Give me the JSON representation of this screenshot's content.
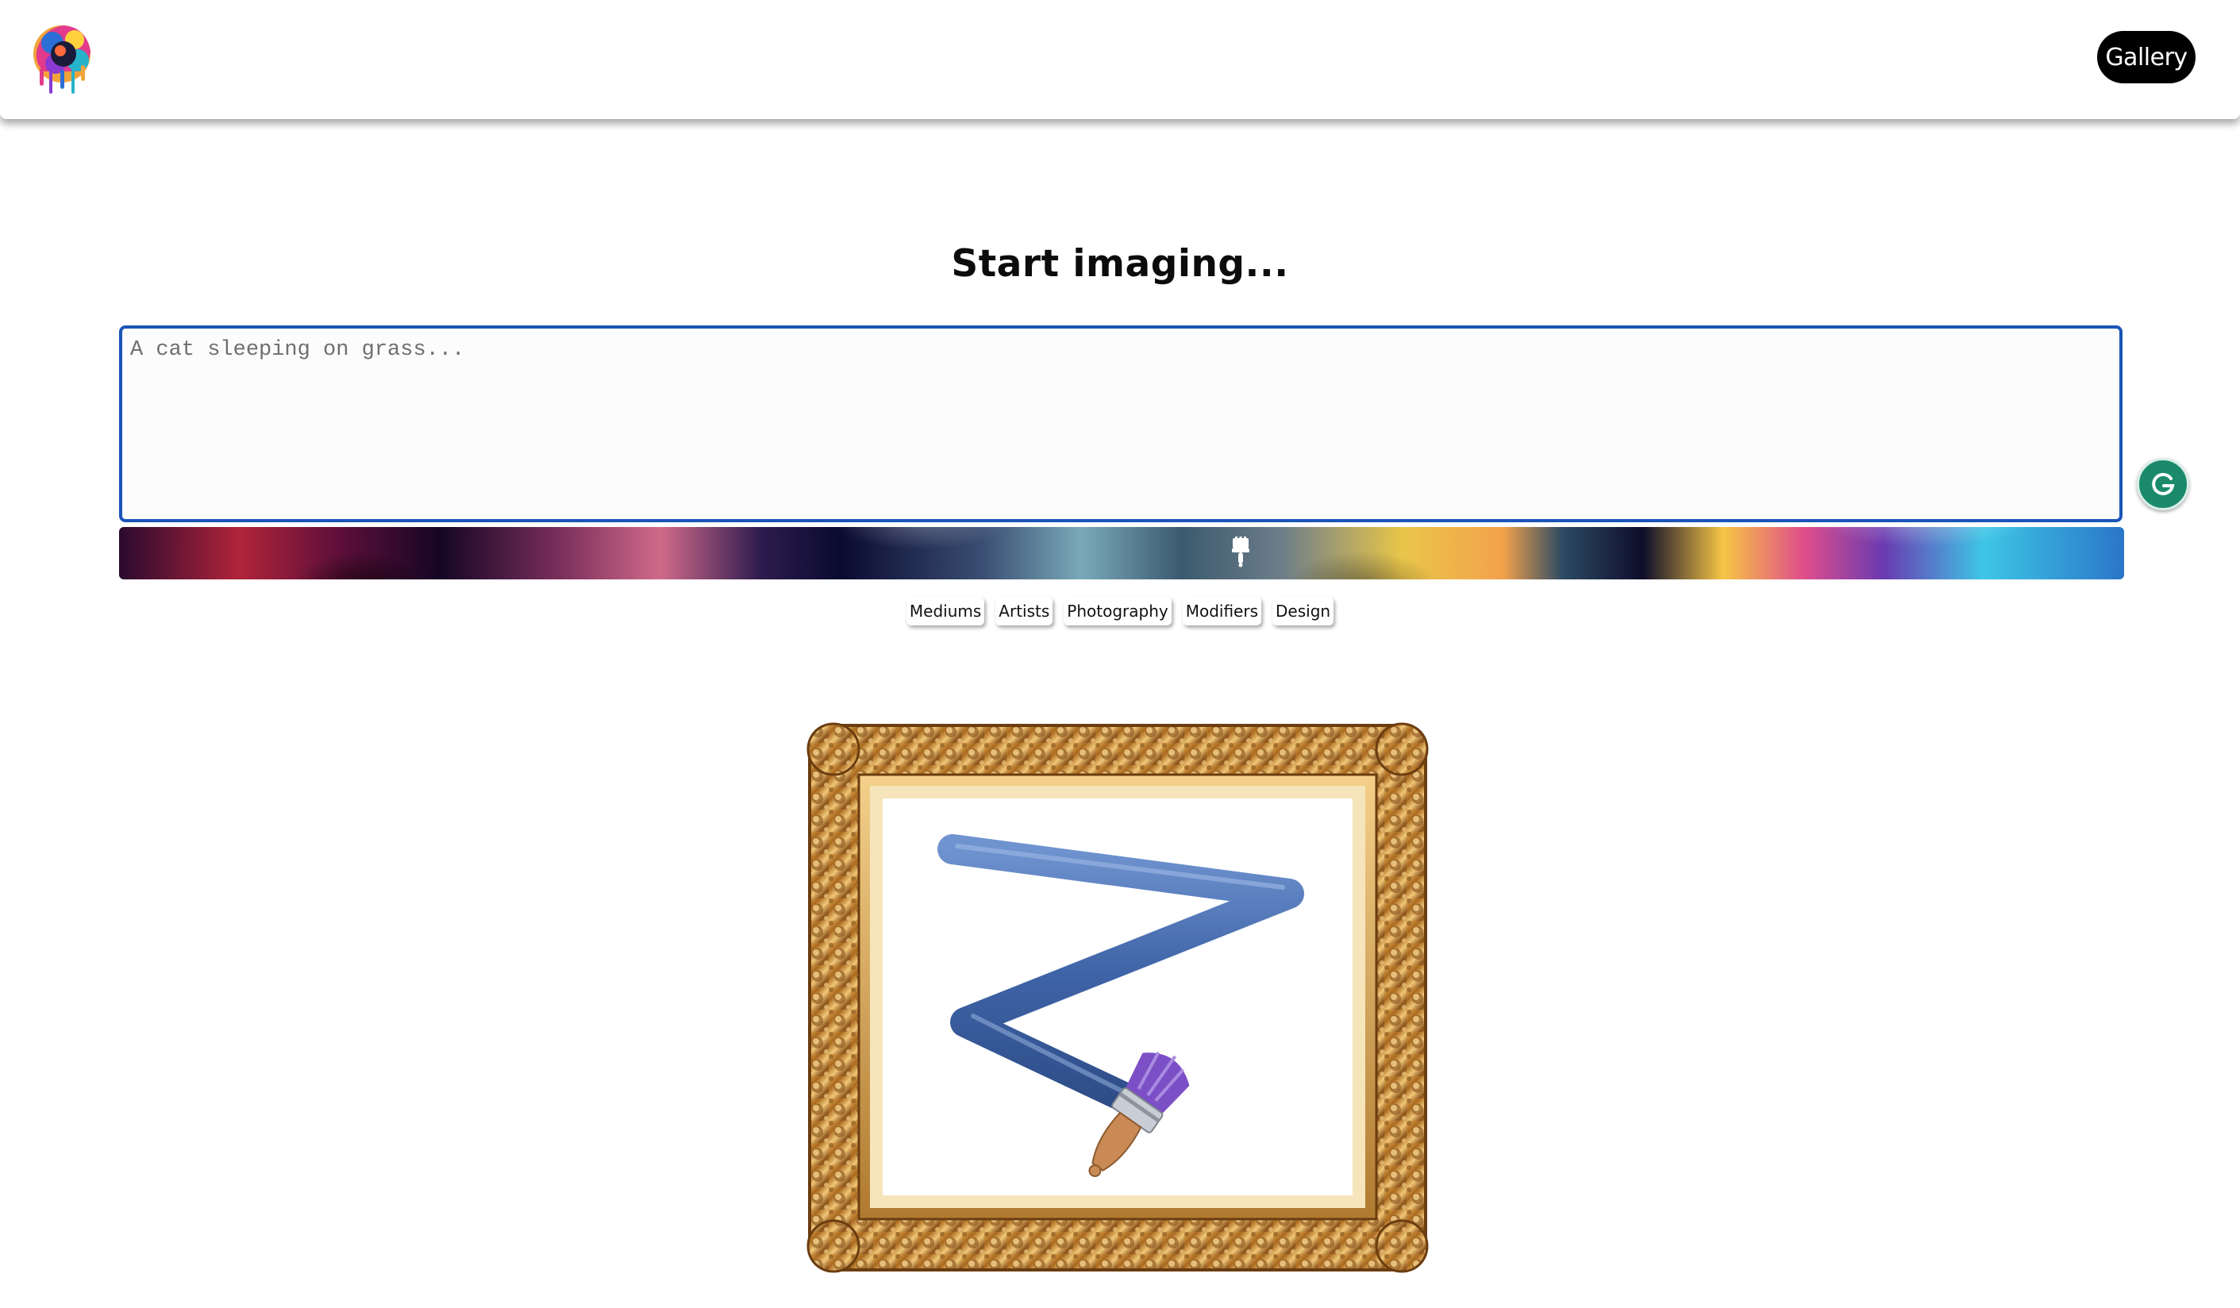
{
  "navbar": {
    "logo_icon": "paint-splash-logo",
    "gallery_label": "Gallery"
  },
  "heading": "Start imaging...",
  "prompt": {
    "value": "",
    "placeholder": "A cat sleeping on grass..."
  },
  "generate_bar": {
    "icon": "paintbrush-icon"
  },
  "chips": [
    "Mediums",
    "Artists",
    "Photography",
    "Modifiers",
    "Design"
  ],
  "illustration": {
    "icon": "gold-frame-with-paint-stroke"
  },
  "grammarly": {
    "icon": "grammarly-icon"
  },
  "colors": {
    "accent_border": "#1a55b8",
    "button_bg": "#000000",
    "stroke_blue": "#4a6eb0",
    "frame_gold": "#b8822e",
    "grammarly_green": "#1a8a6b"
  }
}
